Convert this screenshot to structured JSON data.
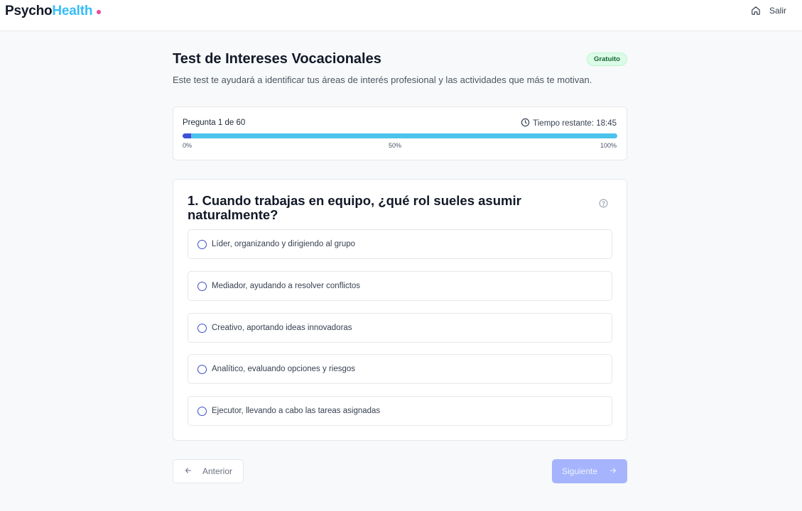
{
  "brand": {
    "part1": "Psycho",
    "part2": "Health"
  },
  "topbar": {
    "exit_label": "Salir"
  },
  "test": {
    "title": "Test de Intereses Vocacionales",
    "badge": "Gratuito",
    "description": "Este test te ayudará a identificar tus áreas de interés profesional y las actividades que más te motivan."
  },
  "progress": {
    "label": "Pregunta 1 de 60",
    "timer_label": "Tiempo restante: 18:45",
    "percent": 2,
    "ticks": [
      "0%",
      "50%",
      "100%"
    ]
  },
  "question": {
    "text": "1. Cuando trabajas en equipo, ¿qué rol sueles asumir naturalmente?",
    "options": [
      "Líder, organizando y dirigiendo al grupo",
      "Mediador, ayudando a resolver conflictos",
      "Creativo, aportando ideas innovadoras",
      "Analítico, evaluando opciones y riesgos",
      "Ejecutor, llevando a cabo las tareas asignadas"
    ]
  },
  "nav": {
    "prev_label": "Anterior",
    "next_label": "Siguiente"
  },
  "icons": {
    "home": "home-icon",
    "clock": "clock-icon",
    "help": "help-circle-icon",
    "arrow_left": "arrow-left-icon",
    "arrow_right": "arrow-right-icon"
  },
  "colors": {
    "brand_dark": "#111827",
    "brand_accent": "#38bdf8",
    "brand_dot": "#ec4899",
    "badge_bg": "#dcfce7",
    "progress_track": "#4cc3ea",
    "progress_fill": "#4050d8",
    "radio": "#3b4fc7",
    "next_button": "#a5b4fc"
  }
}
